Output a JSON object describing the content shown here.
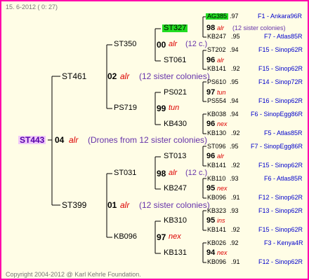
{
  "header_date": "15. 6-2012 ( 0: 27)",
  "footer": "Copyright 2004-2012 @ Karl Kehrle Foundation.",
  "root": {
    "id": "ST443",
    "gen": "04",
    "race": "alr",
    "note": "(Drones from 12 sister colonies)"
  },
  "gen1": [
    {
      "id": "ST461",
      "gen": "02",
      "race": "alr",
      "note": "(12 sister colonies)"
    },
    {
      "id": "ST399",
      "gen": "01",
      "race": "alr",
      "note": "(12 sister colonies)"
    }
  ],
  "gen2": [
    {
      "id": "ST350",
      "gen": "00",
      "race": "alr",
      "note": "(12 c.)"
    },
    {
      "id": "PS719",
      "gen": "99",
      "race": "tun",
      "note": ""
    },
    {
      "id": "ST031",
      "gen": "98",
      "race": "alr",
      "note": "(12 c.)"
    },
    {
      "id": "KB096",
      "gen": "97",
      "race": "nex",
      "note": ""
    }
  ],
  "gen3": [
    {
      "id": "ST327",
      "gen": "98",
      "race": "alr",
      "note": "(12 sister colonies)"
    },
    {
      "id": "ST061",
      "gen": "96",
      "race": "alr",
      "note": ""
    },
    {
      "id": "PS021",
      "gen": "97",
      "race": "tun",
      "note": ""
    },
    {
      "id": "KB430",
      "gen": "96",
      "race": "nex",
      "note": ""
    },
    {
      "id": "ST013",
      "gen": "96",
      "race": "alr",
      "note": ""
    },
    {
      "id": "KB247",
      "gen": "95",
      "race": "nex",
      "note": ""
    },
    {
      "id": "KB310",
      "gen": "95",
      "race": "ins",
      "note": ""
    },
    {
      "id": "KB131",
      "gen": "94",
      "race": "nex",
      "note": ""
    }
  ],
  "gen4": [
    {
      "id": "AG385",
      "yr": ".97",
      "ref": "F1 - Ankara96R"
    },
    {
      "id": "KB247",
      "yr": ".95",
      "ref": "F7 - Atlas85R"
    },
    {
      "id": "ST202",
      "yr": ".94",
      "ref": "F15 - Sinop62R"
    },
    {
      "id": "KB141",
      "yr": ".92",
      "ref": "F15 - Sinop62R"
    },
    {
      "id": "PS610",
      "yr": ".95",
      "ref": "F14 - Sinop72R"
    },
    {
      "id": "PS554",
      "yr": ".94",
      "ref": "F16 - Sinop62R"
    },
    {
      "id": "KB038",
      "yr": ".94",
      "ref": "F6 - SinopEgg86R"
    },
    {
      "id": "KB130",
      "yr": ".92",
      "ref": "F5 - Atlas85R"
    },
    {
      "id": "ST096",
      "yr": ".95",
      "ref": "F7 - SinopEgg86R"
    },
    {
      "id": "KB141",
      "yr": ".92",
      "ref": "F15 - Sinop62R"
    },
    {
      "id": "KB110",
      "yr": ".93",
      "ref": "F6 - Atlas85R"
    },
    {
      "id": "KB096",
      "yr": ".91",
      "ref": "F12 - Sinop62R"
    },
    {
      "id": "KB323",
      "yr": ".93",
      "ref": "F13 - Sinop62R"
    },
    {
      "id": "KB141",
      "yr": ".92",
      "ref": "F15 - Sinop62R"
    },
    {
      "id": "KB026",
      "yr": ".92",
      "ref": "F3 - Kenya4R"
    },
    {
      "id": "KB096",
      "yr": ".91",
      "ref": "F12 - Sinop62R"
    }
  ]
}
